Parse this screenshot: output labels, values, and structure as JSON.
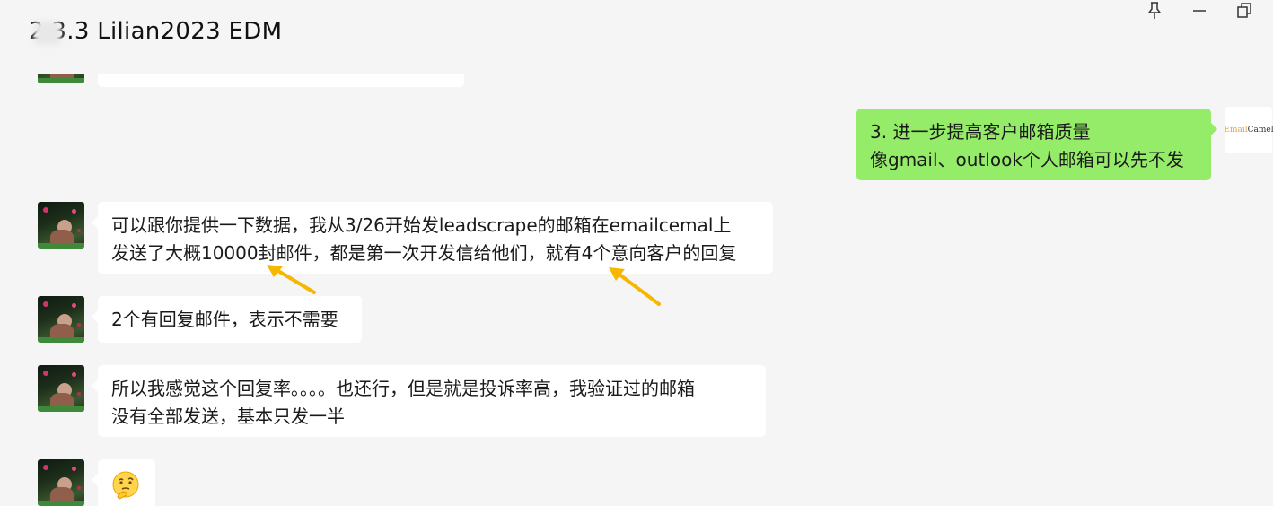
{
  "window": {
    "title": "2  3.3 Lilian2023 EDM",
    "controls": {
      "pin": "pin-icon",
      "minimize": "minimize-icon",
      "restore": "restore-icon"
    }
  },
  "messages": [
    {
      "id": "partial-top",
      "sender": "other",
      "lines": []
    },
    {
      "id": "outgoing-1",
      "sender": "self",
      "avatar_label_part1": "Email",
      "avatar_label_part2": "Camel",
      "lines": [
        "3. 进一步提高客户邮箱质量",
        "像gmail、outlook个人邮箱可以先不发"
      ]
    },
    {
      "id": "incoming-1",
      "sender": "other",
      "lines": [
        "可以跟你提供一下数据，我从3/26开始发leadscrape的邮箱在emailcemal上",
        "发送了大概10000封邮件，都是第一次开发信给他们，就有4个意向客户的回复"
      ]
    },
    {
      "id": "incoming-2",
      "sender": "other",
      "lines": [
        "2个有回复邮件，表示不需要"
      ]
    },
    {
      "id": "incoming-3",
      "sender": "other",
      "lines": [
        "所以我感觉这个回复率。。。。也还行，但是就是投诉率高，我验证过的邮箱",
        "没有全部发送，基本只发一半"
      ]
    },
    {
      "id": "incoming-4",
      "sender": "other",
      "emoji": "thinking-face"
    }
  ],
  "colors": {
    "background": "#f5f5f5",
    "incoming_bubble": "#ffffff",
    "outgoing_bubble": "#95ec69",
    "annotation_arrow": "#f5b700"
  }
}
